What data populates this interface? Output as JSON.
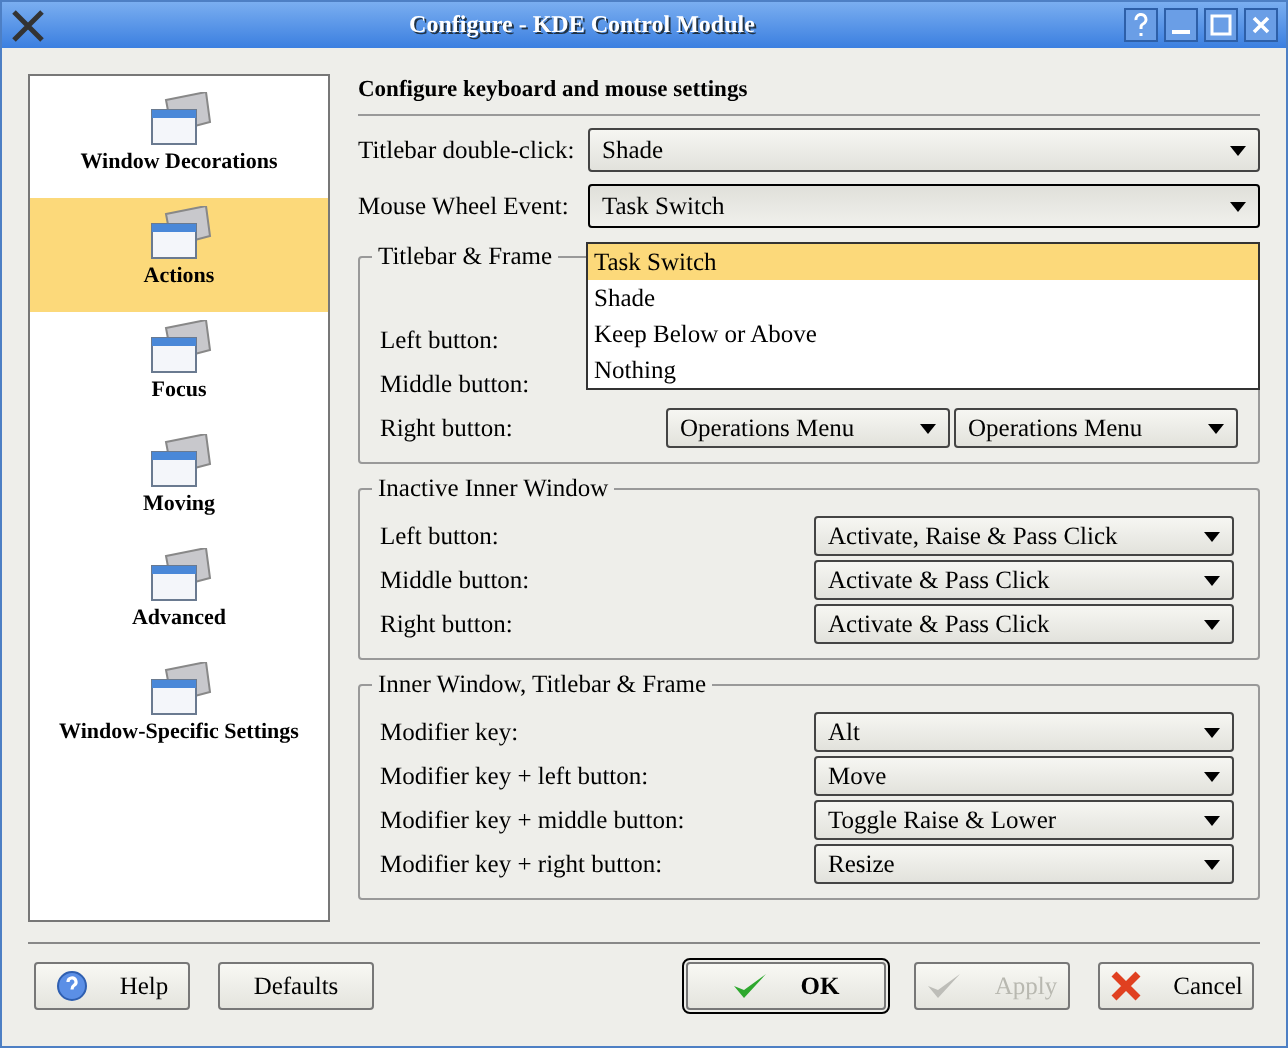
{
  "window": {
    "title": "Configure - KDE Control Module"
  },
  "sidebar": {
    "items": [
      {
        "label": "Window Decorations",
        "selected": false
      },
      {
        "label": "Actions",
        "selected": true
      },
      {
        "label": "Focus",
        "selected": false
      },
      {
        "label": "Moving",
        "selected": false
      },
      {
        "label": "Advanced",
        "selected": false
      },
      {
        "label": "Window-Specific Settings",
        "selected": false
      }
    ]
  },
  "header": "Configure keyboard and mouse settings",
  "top_settings": [
    {
      "label": "Titlebar double-click:",
      "value": "Shade",
      "expanded": false
    },
    {
      "label": "Mouse Wheel Event:",
      "value": "Task Switch",
      "expanded": true,
      "options": [
        {
          "label": "Task Switch",
          "selected": true
        },
        {
          "label": "Shade",
          "selected": false
        },
        {
          "label": "Keep Below or Above",
          "selected": false
        },
        {
          "label": "Nothing",
          "selected": false
        }
      ]
    }
  ],
  "groups": [
    {
      "title": "Titlebar & Frame",
      "kind": "double",
      "rows": [
        {
          "label": "Left button:"
        },
        {
          "label": "Middle button:"
        },
        {
          "label": "Right button:",
          "values": [
            "Operations Menu",
            "Operations Menu"
          ]
        }
      ]
    },
    {
      "title": "Inactive Inner Window",
      "kind": "single",
      "rows": [
        {
          "label": "Left button:",
          "values": [
            "Activate, Raise & Pass Click"
          ]
        },
        {
          "label": "Middle button:",
          "values": [
            "Activate & Pass Click"
          ]
        },
        {
          "label": "Right button:",
          "values": [
            "Activate & Pass Click"
          ]
        }
      ]
    },
    {
      "title": "Inner Window, Titlebar & Frame",
      "kind": "single",
      "rows": [
        {
          "label": "Modifier key:",
          "values": [
            "Alt"
          ]
        },
        {
          "label": "Modifier key + left button:",
          "values": [
            "Move"
          ]
        },
        {
          "label": "Modifier key + middle button:",
          "values": [
            "Toggle Raise & Lower"
          ]
        },
        {
          "label": "Modifier key + right button:",
          "values": [
            "Resize"
          ]
        }
      ]
    }
  ],
  "buttons": [
    {
      "label": "Help",
      "kind": "help",
      "default": false,
      "disabled": false
    },
    {
      "label": "Defaults",
      "kind": "plain",
      "default": false,
      "disabled": false
    },
    {
      "label": "OK",
      "kind": "ok",
      "default": true,
      "disabled": false
    },
    {
      "label": "Apply",
      "kind": "apply",
      "default": false,
      "disabled": true
    },
    {
      "label": "Cancel",
      "kind": "cancel",
      "default": false,
      "disabled": false
    }
  ]
}
